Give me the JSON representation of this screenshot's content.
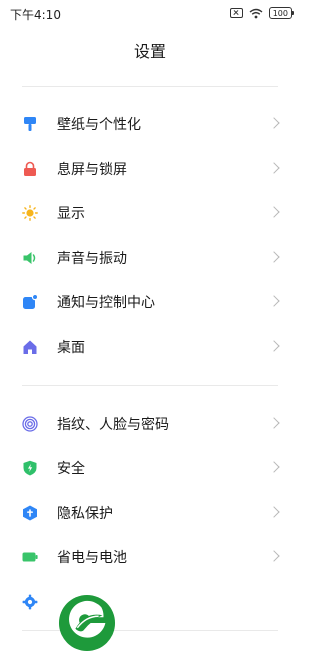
{
  "status_bar": {
    "time": "下午4:10",
    "battery": "100",
    "icons": [
      "sim-off-icon",
      "wifi-icon",
      "battery-icon"
    ]
  },
  "header": {
    "title": "设置"
  },
  "groups": [
    {
      "items": [
        {
          "label": "壁纸与个性化",
          "icon": "wallpaper-icon",
          "color": "#2f86f6"
        },
        {
          "label": "息屏与锁屏",
          "icon": "lock-icon",
          "color": "#ee5a52"
        },
        {
          "label": "显示",
          "icon": "sun-icon",
          "color": "#f6b41c"
        },
        {
          "label": "声音与振动",
          "icon": "speaker-icon",
          "color": "#39c46a"
        },
        {
          "label": "通知与控制中心",
          "icon": "notification-icon",
          "color": "#2f86f6"
        },
        {
          "label": "桌面",
          "icon": "home-icon",
          "color": "#6a6de8"
        }
      ]
    },
    {
      "items": [
        {
          "label": "指纹、人脸与密码",
          "icon": "fingerprint-icon",
          "color": "#6a6de8"
        },
        {
          "label": "安全",
          "icon": "shield-icon",
          "color": "#2fc06a"
        },
        {
          "label": "隐私保护",
          "icon": "privacy-icon",
          "color": "#2f86f6"
        },
        {
          "label": "省电与电池",
          "icon": "battery-saver-icon",
          "color": "#39c46a"
        }
      ]
    }
  ],
  "partial_item": {
    "icon": "gear-icon",
    "color": "#2f86f6"
  },
  "watermark": {
    "icon": "leaf-logo",
    "color": "#1e9a3b"
  }
}
